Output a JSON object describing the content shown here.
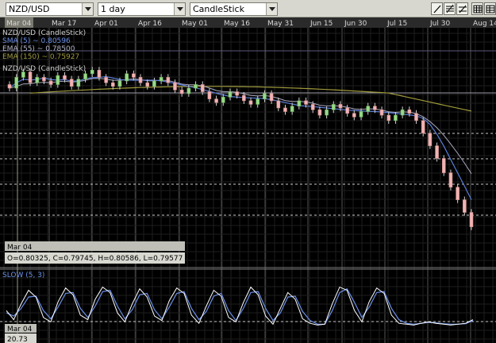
{
  "toolbar": {
    "symbol": "NZD/USD",
    "period": "1 day",
    "chart_type": "CandleStick",
    "tools": [
      {
        "name": "draw-line-icon"
      },
      {
        "name": "fibonacci-icon"
      },
      {
        "name": "channel-icon"
      },
      {
        "name": "grid-icon"
      },
      {
        "name": "table-icon"
      }
    ]
  },
  "date_axis": [
    "Mar 04",
    "Mar 17",
    "Apr 01",
    "Apr 16",
    "May 01",
    "May 16",
    "May 31",
    "Jun 15",
    "Jun 30",
    "Jul 15",
    "Jul 30",
    "Aug 14"
  ],
  "price_panel": {
    "title": "NZD/USD (CandleStick)",
    "sma": "SMA (5) ~ 0.80596",
    "ema55": "EMA (55) ~ 0.78500",
    "ema150": "EMA (150) ~ 0.75927",
    "inner_title": "NZD/USD (CandleStick)",
    "cursor_date": "Mar 04",
    "ohlc": "O=0.80325, C=0.79745, H=0.80586, L=0.79577"
  },
  "osc_panel": {
    "title": "SLOW (5, 3)",
    "cursor_date": "Mar 04",
    "value": "20.73"
  },
  "colors": {
    "background": "#000000",
    "grid": "#3a3a3a",
    "dashed": "#c8c8c8",
    "sma": "#5a7dd8",
    "ema55": "#b4b4c8",
    "ema150": "#a09a3c",
    "candle_up": "#9ad88a",
    "candle_down": "#f0b4b4",
    "stoch_k": "#ffffff",
    "stoch_d": "#6a8fe8"
  },
  "chart_data": {
    "type": "candlestick",
    "x": [
      "Mar 04",
      "Mar 17",
      "Apr 01",
      "Apr 16",
      "May 01",
      "May 16",
      "May 31",
      "Jun 15",
      "Jun 30",
      "Jul 15",
      "Jul 30",
      "Aug 14"
    ],
    "closes": [
      0.797,
      0.803,
      0.806,
      0.8,
      0.803,
      0.801,
      0.799,
      0.804,
      0.802,
      0.798,
      0.802,
      0.805,
      0.807,
      0.803,
      0.8,
      0.798,
      0.801,
      0.805,
      0.803,
      0.8,
      0.798,
      0.801,
      0.803,
      0.8,
      0.796,
      0.794,
      0.797,
      0.799,
      0.795,
      0.791,
      0.789,
      0.792,
      0.795,
      0.793,
      0.79,
      0.788,
      0.791,
      0.794,
      0.79,
      0.786,
      0.784,
      0.787,
      0.79,
      0.788,
      0.785,
      0.782,
      0.785,
      0.788,
      0.786,
      0.783,
      0.781,
      0.784,
      0.787,
      0.785,
      0.782,
      0.779,
      0.782,
      0.785,
      0.783,
      0.779,
      0.772,
      0.765,
      0.758,
      0.75,
      0.742,
      0.735,
      0.728,
      0.72
    ],
    "stochastic": {
      "k": [
        40,
        20,
        55,
        85,
        70,
        25,
        15,
        60,
        90,
        75,
        30,
        20,
        65,
        92,
        80,
        35,
        15,
        55,
        88,
        70,
        28,
        18,
        62,
        90,
        78,
        30,
        12,
        50,
        85,
        72,
        25,
        15,
        58,
        92,
        75,
        28,
        10,
        45,
        80,
        65,
        22,
        12,
        8,
        10,
        55,
        92,
        85,
        40,
        15,
        60,
        90,
        78,
        30,
        12,
        10,
        8,
        12,
        15,
        12,
        10,
        8,
        10,
        12,
        20
      ],
      "d": [
        35,
        28,
        45,
        70,
        72,
        40,
        22,
        48,
        78,
        80,
        45,
        25,
        50,
        82,
        85,
        50,
        22,
        42,
        75,
        78,
        42,
        22,
        48,
        78,
        82,
        45,
        20,
        38,
        72,
        78,
        40,
        18,
        45,
        80,
        82,
        45,
        18,
        35,
        70,
        72,
        38,
        18,
        10,
        10,
        40,
        80,
        88,
        58,
        25,
        48,
        80,
        82,
        45,
        20,
        12,
        10,
        12,
        14,
        13,
        11,
        10,
        10,
        11,
        18
      ]
    }
  }
}
